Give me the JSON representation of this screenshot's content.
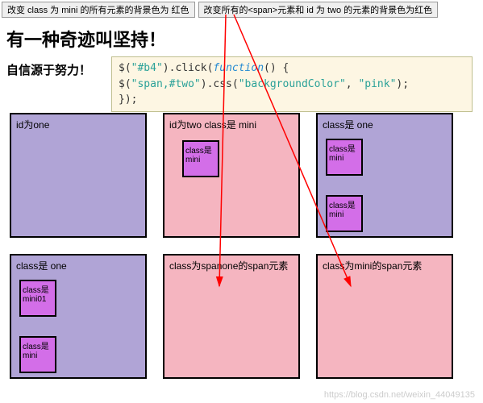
{
  "buttons": {
    "btn1": "改变 class 为 mini 的所有元素的背景色为 红色",
    "btn2": "改变所有的<span>元素和 id 为 two 的元素的背景色为红色"
  },
  "heading": "有一种奇迹叫坚持！",
  "sub_label": "自信源于努力！",
  "code": {
    "l1a": "$(",
    "l1b": "\"#b4\"",
    "l1c": ").click(",
    "l1d": "function",
    "l1e": "() {",
    "l2a": "    $(",
    "l2b": "\"span,#two\"",
    "l2c": ").css(",
    "l2d": "\"backgroundColor\"",
    "l2e": ", ",
    "l2f": "\"pink\"",
    "l2g": ");",
    "l3": "});"
  },
  "boxes": {
    "b1": {
      "label": "id为one"
    },
    "b2": {
      "label": "id为two class是 mini",
      "mini1": "class是mini"
    },
    "b3": {
      "label": "class是 one",
      "mini1": "class是mini",
      "mini2": "class是mini"
    },
    "b4": {
      "label": "class是 one",
      "mini1": "class是mini01",
      "mini2": "class是mini"
    },
    "b5": {
      "label": "class为spanone的span元素"
    },
    "b6": {
      "label": "class为mini的span元素"
    }
  },
  "watermark": "https://blog.csdn.net/weixin_44049135"
}
